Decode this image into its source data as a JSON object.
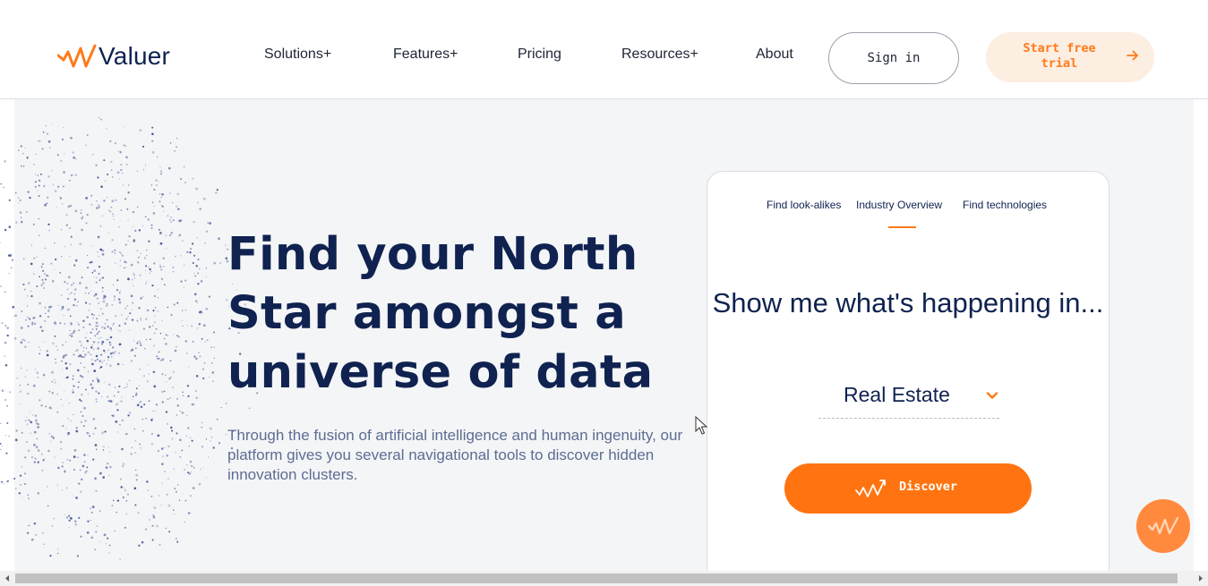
{
  "brand": {
    "name": "Valuer",
    "accent": "#ff7a1a",
    "navy": "#0f2250"
  },
  "nav": {
    "items": [
      {
        "label": "Solutions+"
      },
      {
        "label": "Features+"
      },
      {
        "label": "Pricing"
      },
      {
        "label": "Resources+"
      },
      {
        "label": "About"
      }
    ],
    "sign_in": "Sign in",
    "trial": "Start free trial",
    "trial_icon": "arrow-right-icon"
  },
  "hero": {
    "headline": "Find your North Star amongst a universe of data",
    "subtext": "Through the fusion of artificial intelligence and human ingenuity, our platform gives you several navigational tools to discover hidden innovation clusters."
  },
  "card": {
    "tabs": [
      {
        "label": "Find look-alikes"
      },
      {
        "label": "Industry Overview",
        "active": true
      },
      {
        "label": "Find technologies"
      }
    ],
    "title": "Show me what's happening in...",
    "select": {
      "value": "Real Estate",
      "icon": "chevron-down-icon"
    },
    "discover": {
      "label": "Discover",
      "icon": "trend-up-icon"
    }
  },
  "chat": {
    "icon": "valuer-chat-icon"
  }
}
